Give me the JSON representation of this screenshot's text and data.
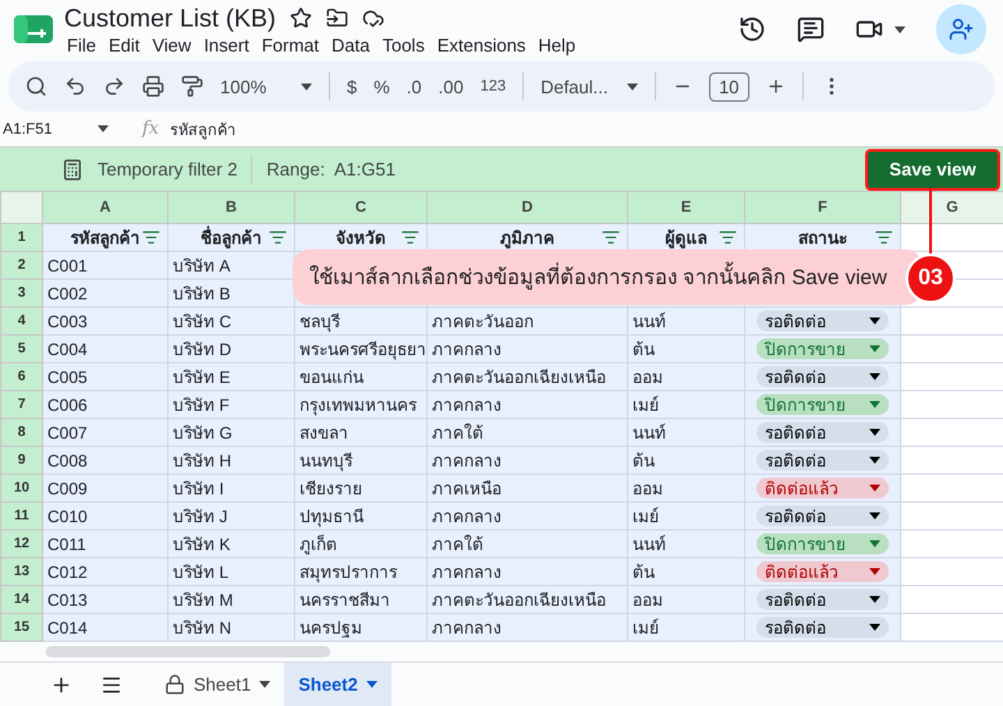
{
  "document": {
    "title": "Customer List (KB)"
  },
  "menu": [
    "File",
    "Edit",
    "View",
    "Insert",
    "Format",
    "Data",
    "Tools",
    "Extensions",
    "Help"
  ],
  "toolbar": {
    "zoom": "100%",
    "currency": "$",
    "percent": "%",
    "decrease_decimals": ".0",
    "increase_decimals": ".00",
    "number_format": "123",
    "font": "Defaul...",
    "font_size": "10"
  },
  "formula_bar": {
    "name_box": "A1:F51",
    "function_label": "fx",
    "formula": "รหัสลูกค้า"
  },
  "filter_bar": {
    "name": "Temporary filter 2",
    "range_label": "Range:",
    "range": "A1:G51",
    "save_button": "Save view"
  },
  "table": {
    "columns": [
      {
        "label": "A",
        "selected": true
      },
      {
        "label": "B",
        "selected": true
      },
      {
        "label": "C",
        "selected": true
      },
      {
        "label": "D",
        "selected": true
      },
      {
        "label": "E",
        "selected": true
      },
      {
        "label": "F",
        "selected": true
      },
      {
        "label": "G",
        "selected": false
      }
    ],
    "rows": [
      {
        "number": "1",
        "kind": "header",
        "cells": [
          "รหัสลูกค้า",
          "ชื่อลูกค้า",
          "จังหวัด",
          "ภูมิภาค",
          "ผู้ดูแล",
          "สถานะ"
        ]
      },
      {
        "number": "2",
        "kind": "data",
        "cells": [
          "C001",
          "บริษัท A"
        ]
      },
      {
        "number": "3",
        "kind": "data",
        "cells": [
          "C002",
          "บริษัท B"
        ]
      },
      {
        "number": "4",
        "kind": "data",
        "cells": [
          "C003",
          "บริษัท C",
          "ชลบุรี",
          "ภาคตะวันออก",
          "นนท์"
        ],
        "status": {
          "label": "รอติดต่อ",
          "kind": "pending"
        }
      },
      {
        "number": "5",
        "kind": "data",
        "cells": [
          "C004",
          "บริษัท D",
          "พระนครศรีอยุธยา",
          "ภาคกลาง",
          "ต้น"
        ],
        "status": {
          "label": "ปิดการขาย",
          "kind": "closed"
        }
      },
      {
        "number": "6",
        "kind": "data",
        "cells": [
          "C005",
          "บริษัท E",
          "ขอนแก่น",
          "ภาคตะวันออกเฉียงเหนือ",
          "ออม"
        ],
        "status": {
          "label": "รอติดต่อ",
          "kind": "pending"
        }
      },
      {
        "number": "7",
        "kind": "data",
        "cells": [
          "C006",
          "บริษัท F",
          "กรุงเทพมหานคร",
          "ภาคกลาง",
          "เมย์"
        ],
        "status": {
          "label": "ปิดการขาย",
          "kind": "closed"
        }
      },
      {
        "number": "8",
        "kind": "data",
        "cells": [
          "C007",
          "บริษัท G",
          "สงขลา",
          "ภาคใต้",
          "นนท์"
        ],
        "status": {
          "label": "รอติดต่อ",
          "kind": "pending"
        }
      },
      {
        "number": "9",
        "kind": "data",
        "cells": [
          "C008",
          "บริษัท H",
          "นนทบุรี",
          "ภาคกลาง",
          "ต้น"
        ],
        "status": {
          "label": "รอติดต่อ",
          "kind": "pending"
        }
      },
      {
        "number": "10",
        "kind": "data",
        "cells": [
          "C009",
          "บริษัท I",
          "เชียงราย",
          "ภาคเหนือ",
          "ออม"
        ],
        "status": {
          "label": "ติดต่อแล้ว",
          "kind": "contacted"
        }
      },
      {
        "number": "11",
        "kind": "data",
        "cells": [
          "C010",
          "บริษัท J",
          "ปทุมธานี",
          "ภาคกลาง",
          "เมย์"
        ],
        "status": {
          "label": "รอติดต่อ",
          "kind": "pending"
        }
      },
      {
        "number": "12",
        "kind": "data",
        "cells": [
          "C011",
          "บริษัท K",
          "ภูเก็ต",
          "ภาคใต้",
          "นนท์"
        ],
        "status": {
          "label": "ปิดการขาย",
          "kind": "closed"
        }
      },
      {
        "number": "13",
        "kind": "data",
        "cells": [
          "C012",
          "บริษัท L",
          "สมุทรปราการ",
          "ภาคกลาง",
          "ต้น"
        ],
        "status": {
          "label": "ติดต่อแล้ว",
          "kind": "contacted"
        }
      },
      {
        "number": "14",
        "kind": "data",
        "cells": [
          "C013",
          "บริษัท M",
          "นครราชสีมา",
          "ภาคตะวันออกเฉียงเหนือ",
          "ออม"
        ],
        "status": {
          "label": "รอติดต่อ",
          "kind": "pending"
        }
      },
      {
        "number": "15",
        "kind": "data",
        "cells": [
          "C014",
          "บริษัท N",
          "นครปฐม",
          "ภาคกลาง",
          "เมย์"
        ],
        "status": {
          "label": "รอติดต่อ",
          "kind": "pending"
        }
      }
    ]
  },
  "callout": {
    "text": "ใช้เมาส์ลากเลือกช่วงข้อมูลที่ต้องการกรอง จากนั้นคลิก Save view",
    "step": "03"
  },
  "sheet_tabs": [
    {
      "label": "Sheet1",
      "locked": true,
      "selected": false
    },
    {
      "label": "Sheet2",
      "locked": false,
      "selected": true
    }
  ]
}
